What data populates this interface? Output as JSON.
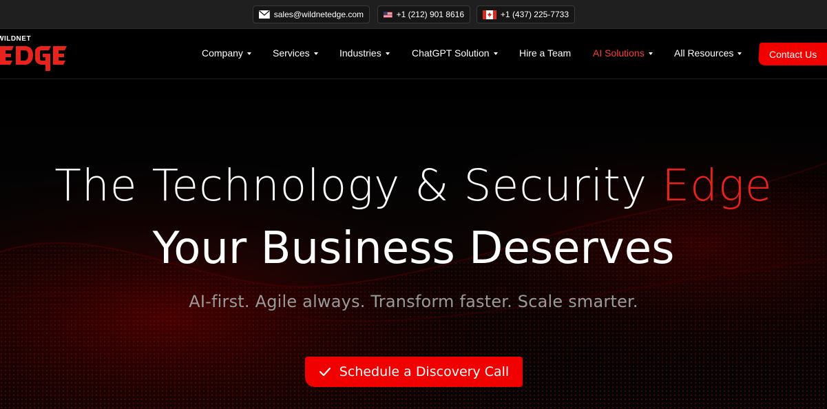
{
  "topbar": {
    "email": "sales@wildnetedge.com",
    "phone_us": "+1 (212) 901 8616",
    "phone_ca": "+1 (437) 225-7733",
    "icons": {
      "email": "mail-icon",
      "us": "us-flag-icon",
      "ca": "canada-flag-icon"
    }
  },
  "logo": {
    "small_text": "WILDNET",
    "main_text": "EDGE"
  },
  "nav": {
    "items": [
      {
        "label": "Company",
        "has_dropdown": true
      },
      {
        "label": "Services",
        "has_dropdown": true
      },
      {
        "label": "Industries",
        "has_dropdown": true
      },
      {
        "label": "ChatGPT Solution",
        "has_dropdown": true
      },
      {
        "label": "Hire a Team",
        "has_dropdown": false
      },
      {
        "label": "AI Solutions",
        "has_dropdown": true,
        "active": true
      },
      {
        "label": "All Resources",
        "has_dropdown": true
      }
    ],
    "contact_label": "Contact Us"
  },
  "hero": {
    "line1_prefix": "The Technology & Security ",
    "line1_accent": "Edge",
    "line2": "Your Business Deserves",
    "tagline": "AI-first. Agile always. Transform faster. Scale smarter.",
    "cta_label": "Schedule a Discovery Call",
    "cta_icon": "check-icon"
  },
  "colors": {
    "accent": "#f10000",
    "accent_text": "#e8231e",
    "background": "#000000",
    "topbar": "#1f1f1f"
  }
}
